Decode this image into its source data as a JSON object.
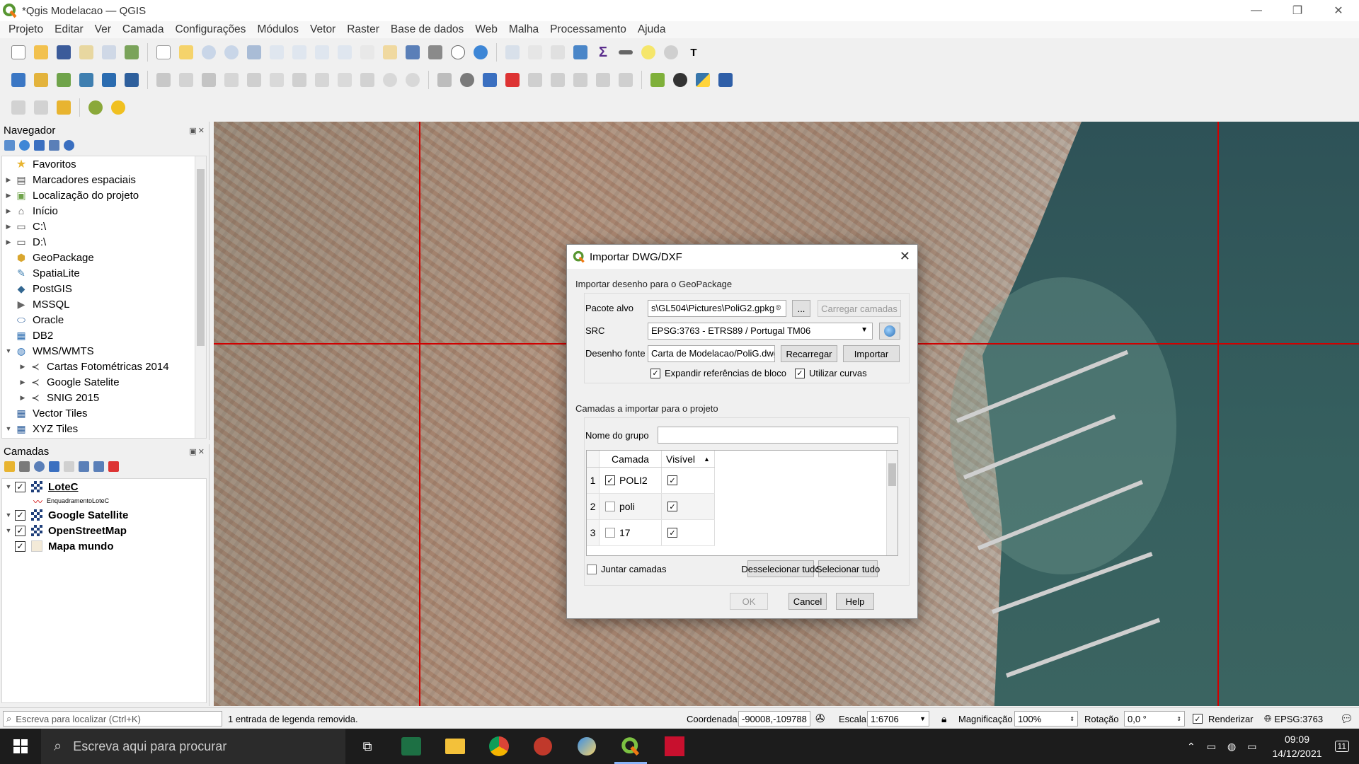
{
  "window": {
    "title": "*Qgis Modelacao — QGIS",
    "minimize_icon": "minimize-icon",
    "maximize_icon": "restore-icon",
    "close_icon": "close-icon"
  },
  "menu": [
    "Projeto",
    "Editar",
    "Ver",
    "Camada",
    "Configurações",
    "Módulos",
    "Vetor",
    "Raster",
    "Base de dados",
    "Web",
    "Malha",
    "Processamento",
    "Ajuda"
  ],
  "navigator": {
    "title": "Navegador",
    "items": [
      {
        "label": "Favoritos",
        "icon": "star-icon",
        "expand": "",
        "indent": 0
      },
      {
        "label": "Marcadores espaciais",
        "icon": "bookmark-icon",
        "expand": "▶",
        "indent": 0
      },
      {
        "label": "Localização do projeto",
        "icon": "project-home-icon",
        "expand": "▶",
        "indent": 0
      },
      {
        "label": "Início",
        "icon": "home-icon",
        "expand": "▶",
        "indent": 0
      },
      {
        "label": "C:\\",
        "icon": "folder-icon",
        "expand": "▶",
        "indent": 0
      },
      {
        "label": "D:\\",
        "icon": "folder-icon",
        "expand": "▶",
        "indent": 0
      },
      {
        "label": "GeoPackage",
        "icon": "geopackage-icon",
        "expand": "",
        "indent": 0
      },
      {
        "label": "SpatiaLite",
        "icon": "spatialite-icon",
        "expand": "",
        "indent": 0
      },
      {
        "label": "PostGIS",
        "icon": "postgis-icon",
        "expand": "",
        "indent": 0
      },
      {
        "label": "MSSQL",
        "icon": "mssql-icon",
        "expand": "",
        "indent": 0
      },
      {
        "label": "Oracle",
        "icon": "oracle-icon",
        "expand": "",
        "indent": 0
      },
      {
        "label": "DB2",
        "icon": "db2-icon",
        "expand": "",
        "indent": 0
      },
      {
        "label": "WMS/WMTS",
        "icon": "globe-icon",
        "expand": "▼",
        "indent": 0
      },
      {
        "label": "Cartas Fotométricas 2014",
        "icon": "wms-layer-icon",
        "expand": "▶",
        "indent": 1
      },
      {
        "label": "Google Satelite",
        "icon": "wms-layer-icon",
        "expand": "▶",
        "indent": 1
      },
      {
        "label": "SNIG 2015",
        "icon": "wms-layer-icon",
        "expand": "▶",
        "indent": 1
      },
      {
        "label": "Vector Tiles",
        "icon": "grid-icon",
        "expand": "",
        "indent": 0
      },
      {
        "label": "XYZ Tiles",
        "icon": "grid-icon",
        "expand": "▼",
        "indent": 0
      }
    ]
  },
  "layers": {
    "title": "Camadas",
    "items": [
      {
        "label": "LoteC",
        "underline": true,
        "checked": true,
        "expand": "▼",
        "sub": "EnquadramentoLoteC"
      },
      {
        "label": "Google Satellite",
        "checked": true,
        "expand": "▼"
      },
      {
        "label": "OpenStreetMap",
        "checked": true,
        "expand": "▼"
      },
      {
        "label": "Mapa mundo",
        "checked": true,
        "expand": ""
      }
    ]
  },
  "dialog": {
    "title": "Importar DWG/DXF",
    "section1": "Importar desenho para o GeoPackage",
    "pacote_label": "Pacote alvo",
    "pacote_value": "s\\GL504\\Pictures\\PoliG2.gpkg",
    "browse_label": "...",
    "carregar_label": "Carregar camadas",
    "src_label": "SRC",
    "src_value": "EPSG:3763 - ETRS89 / Portugal TM06",
    "desenho_label": "Desenho fonte",
    "desenho_value": "Carta de Modelacao/PoliG.dwg",
    "recarregar_label": "Recarregar",
    "importar_label": "Importar",
    "expandir_label": "Expandir referências de bloco",
    "curvas_label": "Utilizar curvas",
    "section2": "Camadas a importar para o projeto",
    "grupo_label": "Nome do grupo",
    "grupo_value": "",
    "col_camada": "Camada",
    "col_visivel": "Visível",
    "rows": [
      {
        "num": "1",
        "name": "POLI2",
        "import": true,
        "visible": true
      },
      {
        "num": "2",
        "name": "poli",
        "import": false,
        "visible": true
      },
      {
        "num": "3",
        "name": "17",
        "import": false,
        "visible": true
      }
    ],
    "juntar_label": "Juntar camadas",
    "desselecionar_label": "Desselecionar tudo",
    "selecionar_label": "Selecionar tudo",
    "ok_label": "OK",
    "cancel_label": "Cancel",
    "help_label": "Help"
  },
  "status": {
    "search_placeholder": "Escreva para localizar (Ctrl+K)",
    "message": "1 entrada de legenda removida.",
    "coord_label": "Coordenada",
    "coord_value": "-90008,-109788",
    "scale_label": "Escala",
    "scale_value": "1:6706",
    "mag_label": "Magnificação",
    "mag_value": "100%",
    "rot_label": "Rotação",
    "rot_value": "0,0 °",
    "render_label": "Renderizar",
    "epsg_label": "EPSG:3763"
  },
  "taskbar": {
    "search_placeholder": "Escreva aqui para procurar",
    "time": "09:09",
    "date": "14/12/2021",
    "notif_count": "11"
  },
  "colors": {
    "grid_line": "#d00000",
    "accent": "#589632"
  }
}
